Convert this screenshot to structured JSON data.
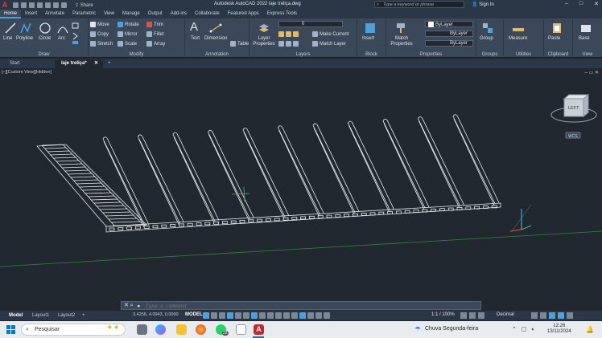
{
  "titlebar": {
    "logo": "A",
    "share": "Share",
    "title": "Autodesk AutoCAD 2022    laje treliça.dwg",
    "search_placeholder": "Type a keyword or phrase",
    "signin": "Sign In"
  },
  "ribbon_tabs": [
    "Home",
    "Insert",
    "Annotate",
    "Parametric",
    "View",
    "Manage",
    "Output",
    "Add-ins",
    "Collaborate",
    "Featured Apps",
    "Express Tools"
  ],
  "ribbon": {
    "draw": {
      "label": "Draw",
      "line": "Line",
      "polyline": "Polyline",
      "circle": "Circle",
      "arc": "Arc"
    },
    "modify": {
      "label": "Modify",
      "move": "Move",
      "rotate": "Rotate",
      "trim": "Trim",
      "copy": "Copy",
      "mirror": "Mirror",
      "fillet": "Fillet",
      "stretch": "Stretch",
      "scale": "Scale",
      "array": "Array"
    },
    "annotation": {
      "label": "Annotation",
      "text": "Text",
      "dimension": "Dimension",
      "table": "Table"
    },
    "layers": {
      "label": "Layers",
      "layer_properties": "Layer Properties",
      "current_layer": "0",
      "make_current": "Make Current",
      "match_layer": "Match Layer"
    },
    "block": {
      "label": "Block",
      "insert": "Insert"
    },
    "properties": {
      "label": "Properties",
      "match_properties": "Match Properties",
      "color": "ByLayer",
      "linetype": "ByLayer",
      "lineweight": "ByLayer"
    },
    "groups": {
      "label": "Groups",
      "group": "Group"
    },
    "utilities": {
      "label": "Utilities",
      "measure": "Measure"
    },
    "clipboard": {
      "label": "Clipboard",
      "paste": "Paste"
    },
    "view": {
      "label": "View",
      "base": "Base"
    }
  },
  "file_tabs": {
    "start": "Start",
    "file": "laje treliça*",
    "plus": "+"
  },
  "viewport": {
    "label": "[–][Custom View][Hidden]",
    "viewcube_face": "LEFT",
    "wcs": "WCS",
    "joist_count": 11
  },
  "command": {
    "placeholder": "Type a command"
  },
  "status": {
    "layout_tabs": [
      "Model",
      "Layout1",
      "Layout2"
    ],
    "plus": "+",
    "coords": "3.4256, 4.0943, 0.0000",
    "model": "MODEL",
    "scale": "1:1 / 100%",
    "units": "Decimal"
  },
  "taskbar": {
    "search": "Pesquisar",
    "weather": "Chuva Segunda-feira",
    "time": "12:26",
    "date": "13/11/2024",
    "whatsapp_badge": "22"
  },
  "colors": {
    "accent": "#4aa3df",
    "autocad_red": "#e53935",
    "viewport_bg": "#212830"
  }
}
